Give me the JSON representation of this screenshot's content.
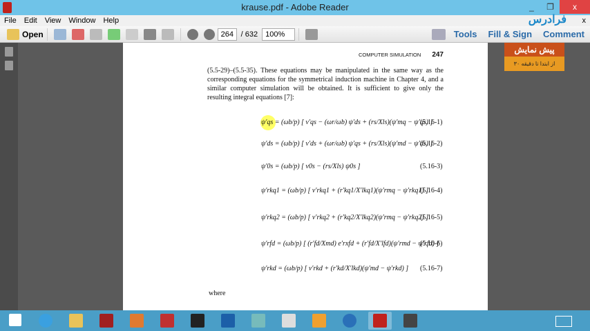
{
  "window": {
    "title": "krause.pdf - Adobe Reader",
    "minimize": "_",
    "restore": "❐",
    "close": "x"
  },
  "menu": [
    "File",
    "Edit",
    "View",
    "Window",
    "Help"
  ],
  "menu_close": "x",
  "toolbar": {
    "open": "Open",
    "page_current": "264",
    "page_total": "/ 632",
    "zoom": "100%",
    "tools": "Tools",
    "fill_sign": "Fill & Sign",
    "comment": "Comment"
  },
  "page": {
    "header": "COMPUTER SIMULATION",
    "page_number": "247",
    "paragraph": "(5.5-29)–(5.5-35). These equations may be manipulated in the same way as the corresponding equations for the symmetrical induction machine in Chapter 4, and a similar computer simulation will be obtained. It is sufficient to give only the resulting integral equations [7]:",
    "equations": [
      {
        "expr": "ψ′qs = (ωb/p) [ v′qs − (ωr/ωb) ψ′ds + (rs/Xls)(ψ′mq − ψ′qs) ]",
        "num": "(5.16-1)"
      },
      {
        "expr": "ψ′ds = (ωb/p) [ v′ds + (ωr/ωb) ψ′qs + (rs/Xls)(ψ′md − ψ′ds) ]",
        "num": "(5.16-2)"
      },
      {
        "expr": "ψ′0s = (ωb/p) [ v0s − (rs/Xls) ψ0s ]",
        "num": "(5.16-3)"
      },
      {
        "expr": "ψ′rkq1 = (ωb/p) [ v′rkq1 + (r′kq1/X′lkq1)(ψ′rmq − ψ′rkq1) ]",
        "num": "(5.16-4)"
      },
      {
        "expr": "ψ′rkq2 = (ωb/p) [ v′rkq2 + (r′kq2/X′lkq2)(ψ′rmq − ψ′rkq2) ]",
        "num": "(5.16-5)"
      },
      {
        "expr": "ψ′rfd = (ωb/p) [ (r′fd/Xmd) e′rxfd + (r′fd/X′lfd)(ψ′rmd − ψ′rfd) ]",
        "num": "(5.16-6)"
      },
      {
        "expr": "ψ′rkd = (ωb/p) [ v′rkd + (r′kd/X′lkd)(ψ′md − ψ′rkd) ]",
        "num": "(5.16-7)"
      }
    ],
    "where": "where"
  },
  "promo": {
    "title": "پیش نمایش",
    "subtitle": "از ابتدا تا دقیقه ۳۰",
    "logo": "فرادرس"
  }
}
